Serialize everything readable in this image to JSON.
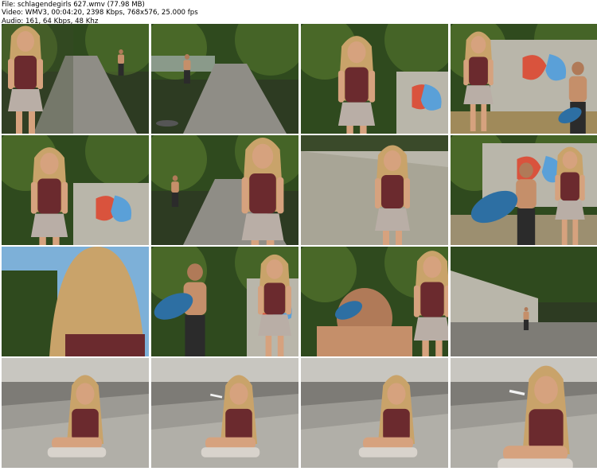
{
  "header": {
    "file_line": "File: schlagendegirls 627.wmv (77.98 MB)",
    "video_line": "Video: WMV3, 00:04:20, 2398 Kbps, 768x576, 25.000 fps",
    "audio_line": "Audio: 161, 64 Kbps, 48 Khz"
  },
  "grid": {
    "rows": 4,
    "cols": 4
  },
  "thumbnails": [
    {
      "scene": "girl-back-street"
    },
    {
      "scene": "street-man-running"
    },
    {
      "scene": "girl-wall-graffiti"
    },
    {
      "scene": "girl-man-graffiti"
    },
    {
      "scene": "girl-closeup-bushes"
    },
    {
      "scene": "street-girl-back"
    },
    {
      "scene": "wall-girl-profile"
    },
    {
      "scene": "man-bag-girl-walking"
    },
    {
      "scene": "girl-hair-back"
    },
    {
      "scene": "man-bag-girl-wall"
    },
    {
      "scene": "man-face-closeup"
    },
    {
      "scene": "street-wide-figure"
    },
    {
      "scene": "girl-sitting-underpass"
    },
    {
      "scene": "girl-sitting-smoking"
    },
    {
      "scene": "girl-sitting-looking-down"
    },
    {
      "scene": "girl-smoking-closeup"
    }
  ],
  "colors": {
    "foliage": "#2f4a1e",
    "foliage_light": "#5c7d2f",
    "pavement": "#8f8d86",
    "wall": "#b9b6aa",
    "skin": "#d6a27e",
    "hair": "#c9a36a",
    "top": "#6b2a2e",
    "skirt": "#b9aea6",
    "underpass": "#9c9a94",
    "bag": "#2d6fa3"
  }
}
